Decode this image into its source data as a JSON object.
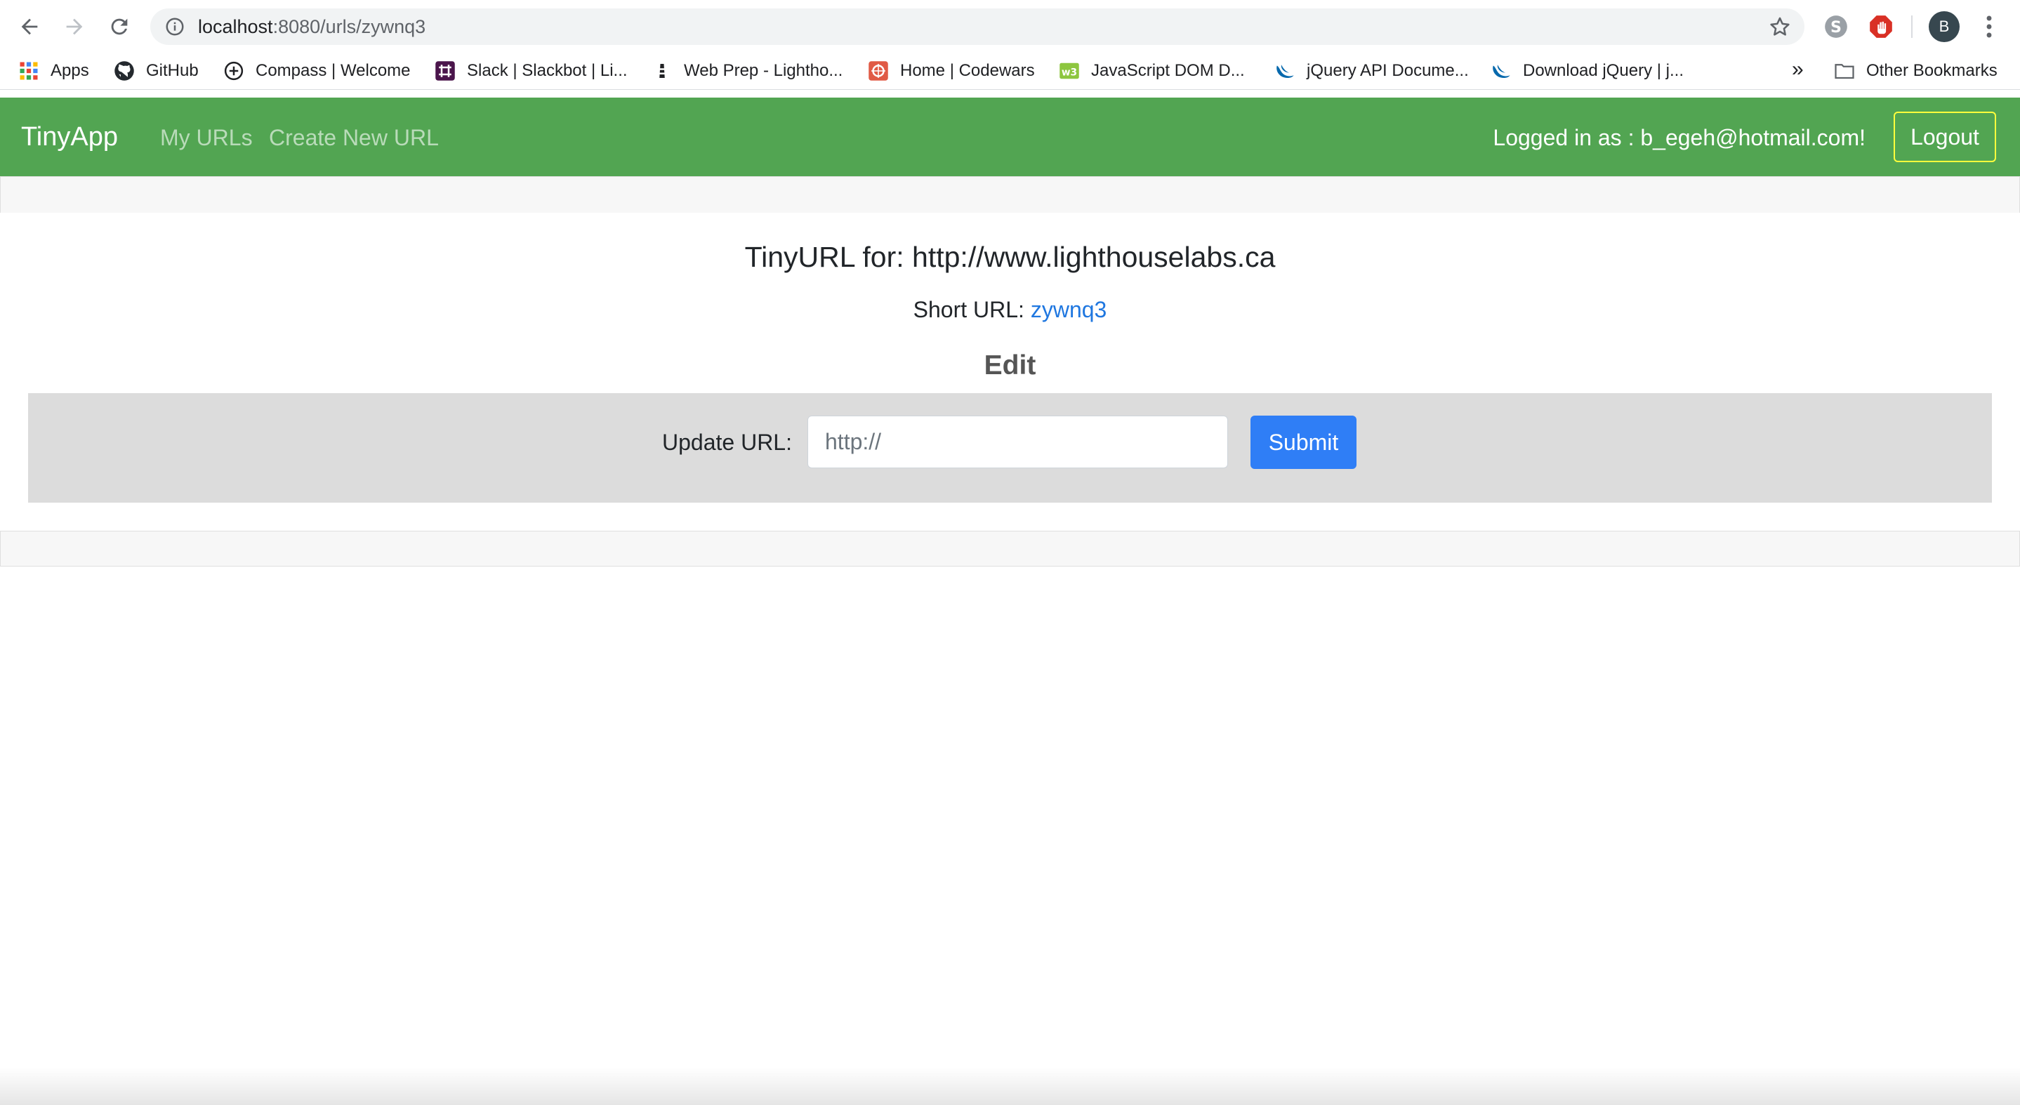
{
  "browser": {
    "url_host": "localhost",
    "url_path": ":8080/urls/zywnq3",
    "profile_initial": "B",
    "bookmarks": [
      {
        "label": "Apps",
        "icon": "apps-grid-icon"
      },
      {
        "label": "GitHub",
        "icon": "github-icon"
      },
      {
        "label": "Compass | Welcome",
        "icon": "compass-icon"
      },
      {
        "label": "Slack | Slackbot | Li...",
        "icon": "slack-icon"
      },
      {
        "label": "Web Prep - Lightho...",
        "icon": "lighthouse-icon"
      },
      {
        "label": "Home | Codewars",
        "icon": "codewars-icon"
      },
      {
        "label": "JavaScript DOM D...",
        "icon": "w3schools-icon"
      },
      {
        "label": "jQuery API Docume...",
        "icon": "jquery-icon"
      },
      {
        "label": "Download jQuery | j...",
        "icon": "jquery-icon"
      }
    ],
    "bookmarks_overflow": "»",
    "other_bookmarks": "Other Bookmarks"
  },
  "navbar": {
    "brand": "TinyApp",
    "links": [
      "My URLs",
      "Create New URL"
    ],
    "logged_in_text": "Logged in as : b_egeh@hotmail.com!",
    "logout_label": "Logout",
    "color": "#52a552"
  },
  "main": {
    "title": "TinyURL for: http://www.lighthouselabs.ca",
    "short_url_label": "Short URL:",
    "short_url_value": "zywnq3",
    "edit_heading": "Edit",
    "update_label": "Update URL:",
    "update_placeholder": "http://",
    "submit_label": "Submit",
    "submit_color": "#2f7ef6"
  }
}
